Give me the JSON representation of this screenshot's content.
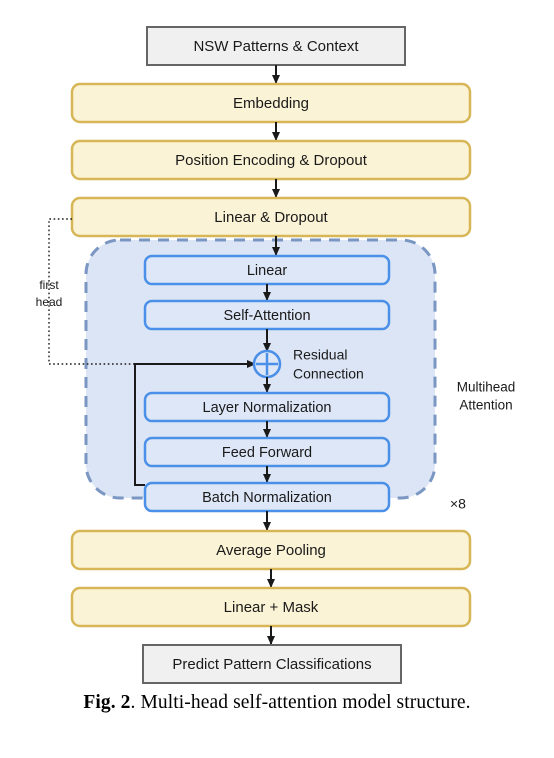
{
  "figure": {
    "caption_prefix": "Fig. 2",
    "caption_text": ". Multi-head self-attention model structure."
  },
  "colors": {
    "yellow_fill": "#FBF3D5",
    "yellow_stroke": "#D6B656",
    "gray_fill": "#F0F0F0",
    "gray_stroke": "#666666",
    "blue_box_fill": "#DEE7F7",
    "blue_box_stroke": "#4A90E8",
    "container_fill": "#DCE5F5",
    "container_stroke": "#7A96C2",
    "arrow": "#1a1a1a",
    "text": "#1a1a1a"
  },
  "nodes": {
    "input": "NSW Patterns & Context",
    "embedding": "Embedding",
    "position_encoding": "Position Encoding & Dropout",
    "linear_dropout": "Linear & Dropout",
    "linear": "Linear",
    "self_attention": "Self-Attention",
    "layer_norm": "Layer Normalization",
    "feed_forward": "Feed Forward",
    "batch_norm": "Batch Normalization",
    "average_pooling": "Average Pooling",
    "linear_mask": "Linear + Mask",
    "output": "Predict Pattern Classifications"
  },
  "annotations": {
    "first_head_line1": "first",
    "first_head_line2": "head",
    "residual_line1": "Residual",
    "residual_line2": "Connection",
    "multihead_line1": "Multihead",
    "multihead_line2": "Attention",
    "repeat_count": "×8",
    "plus_symbol": "⊕"
  }
}
